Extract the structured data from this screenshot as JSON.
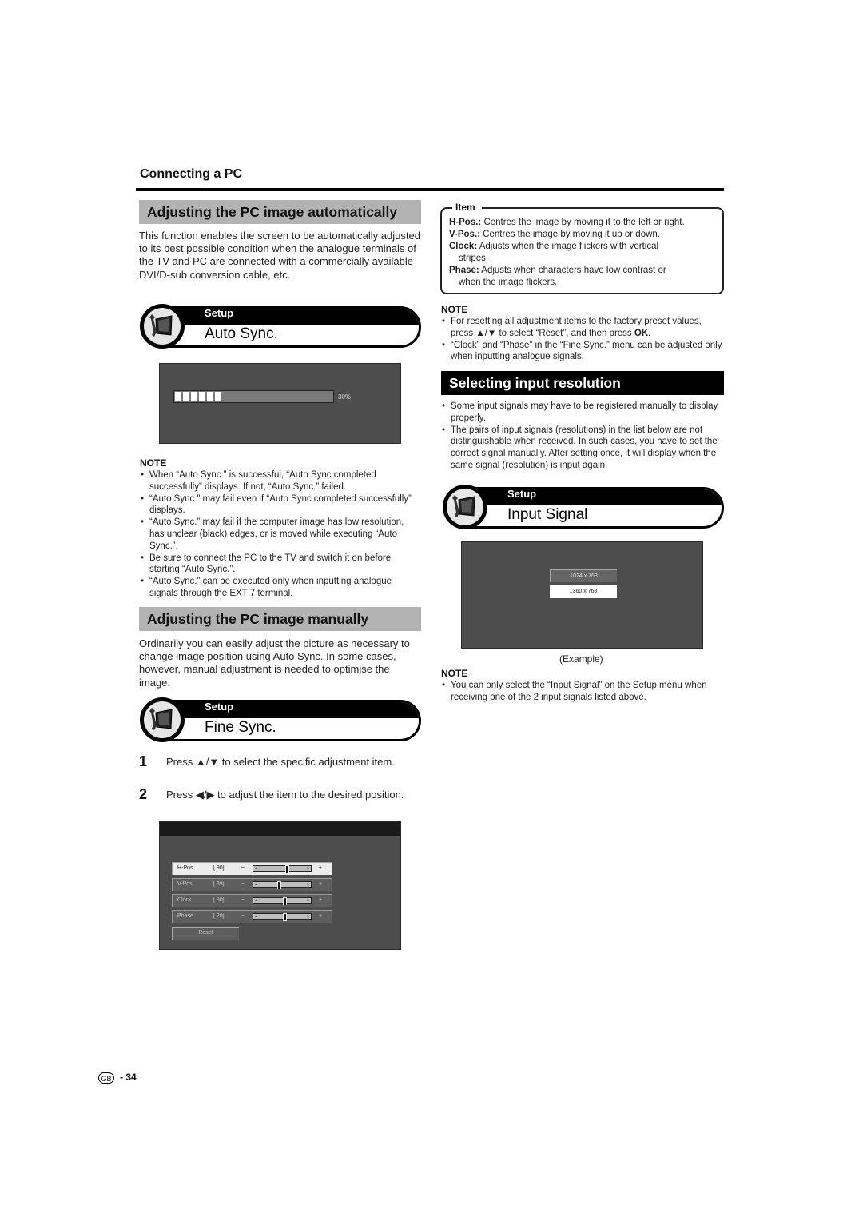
{
  "header": {
    "section": "Connecting a PC"
  },
  "auto_section": {
    "heading": "Adjusting the PC image automatically",
    "body": "This function enables the screen to be automatically adjusted to its best possible condition when the analogue terminals of the TV and PC are connected with a commercially available DVI/D-sub conversion cable, etc.",
    "banner": {
      "category": "Setup",
      "title": "Auto Sync."
    },
    "screen": {
      "progress_percent": 30,
      "progress_label": "30%",
      "segments_filled": 6
    },
    "note_title": "NOTE",
    "notes": [
      "When “Auto Sync.” is successful, “Auto Sync completed successfully” displays. If not, “Auto Sync.” failed.",
      "“Auto Sync.” may fail even if “Auto Sync completed successfully” displays.",
      "“Auto Sync.” may fail if the computer image has low resolution, has unclear (black) edges, or is moved while executing “Auto Sync.”.",
      "Be sure to connect the PC to the TV and switch it on before starting “Auto Sync.”.",
      "“Auto Sync.” can be executed only when inputting analogue signals through the EXT 7 terminal."
    ]
  },
  "manual_section": {
    "heading": "Adjusting the PC image manually",
    "body": "Ordinarily you can easily adjust the picture as necessary to change image position using Auto Sync. In some cases, however, manual adjustment is needed to optimise the image.",
    "banner": {
      "category": "Setup",
      "title": "Fine Sync."
    },
    "steps": [
      {
        "num": "1",
        "text": "Press ▲/▼ to select the specific adjustment item."
      },
      {
        "num": "2",
        "text": "Press ◀/▶ to adjust the item to the desired position."
      }
    ],
    "screen": {
      "rows": [
        {
          "name": "H-Pos.",
          "value": "[ 90]",
          "position": 0.56,
          "active": true
        },
        {
          "name": "V-Pos.",
          "value": "[ 39]",
          "position": 0.42,
          "active": false
        },
        {
          "name": "Clock",
          "value": "[ 90]",
          "position": 0.52,
          "active": false
        },
        {
          "name": "Phase",
          "value": "[ 20]",
          "position": 0.52,
          "active": false
        }
      ],
      "minus": "–",
      "plus": "+",
      "left_arrow": "◂",
      "right_arrow": "▸",
      "reset_label": "Reset"
    }
  },
  "item_box": {
    "label": "Item",
    "entries": [
      {
        "term": "H-Pos.:",
        "desc": "Centres the image by moving it to the left or right.",
        "cont": ""
      },
      {
        "term": "V-Pos.:",
        "desc": "Centres the image by moving it up or down.",
        "cont": ""
      },
      {
        "term": "Clock:",
        "desc": "Adjusts when the image flickers with vertical",
        "cont": "stripes."
      },
      {
        "term": "Phase:",
        "desc": "Adjusts when characters have low contrast or",
        "cont": "when the image flickers."
      }
    ]
  },
  "right_note": {
    "title": "NOTE",
    "note1_a": "For resetting all adjustment items to the factory preset values, press ▲/▼ to select “Reset”, and then press ",
    "note1_bold": "OK",
    "note1_end": ".",
    "note2": "“Clock” and “Phase” in the “Fine Sync.” menu can be adjusted only when inputting analogue signals."
  },
  "resolution_section": {
    "heading": "Selecting input resolution",
    "bullets": [
      "Some input signals may have to be registered manually to display properly.",
      "The pairs of input signals (resolutions) in the list below are not distinguishable when received. In such cases, you have to set the correct signal manually. After setting once, it will display when the same signal (resolution) is input again."
    ],
    "banner": {
      "category": "Setup",
      "title": "Input Signal"
    },
    "screen": {
      "options": [
        "1024 x 768",
        "1360 x 768"
      ],
      "selected_index": 1
    },
    "caption": "(Example)",
    "note_title": "NOTE",
    "notes": [
      "You can only select the “Input Signal” on the Setup menu when receiving one of the 2 input signals listed above."
    ]
  },
  "footer": {
    "region_badge": "GB",
    "page": "- 34"
  }
}
